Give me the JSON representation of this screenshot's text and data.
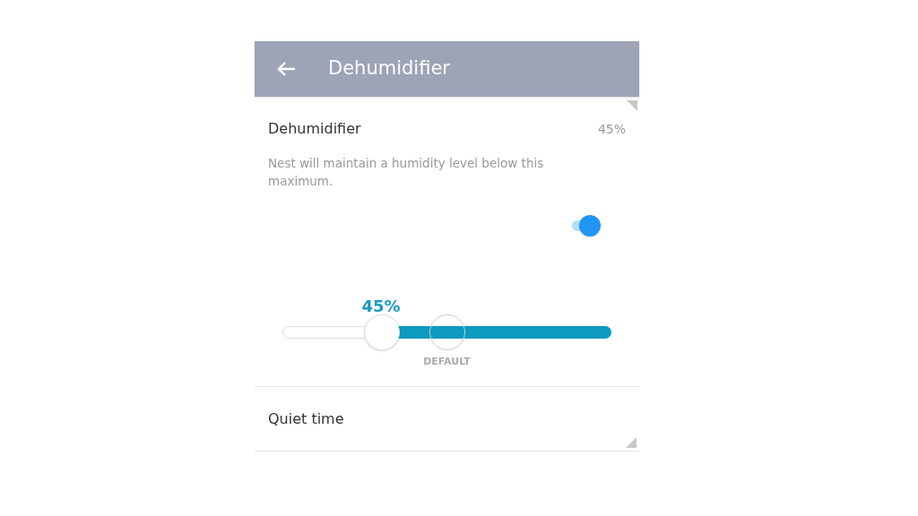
{
  "header": {
    "title": "Dehumidifier"
  },
  "setting": {
    "label": "Dehumidifier",
    "value": "45%",
    "description": "Nest will maintain a humidity level below this maximum.",
    "on": true
  },
  "slider": {
    "reading": "45%",
    "default_label": "DEFAULT"
  },
  "rows": [
    {
      "label": "Quiet time"
    }
  ]
}
